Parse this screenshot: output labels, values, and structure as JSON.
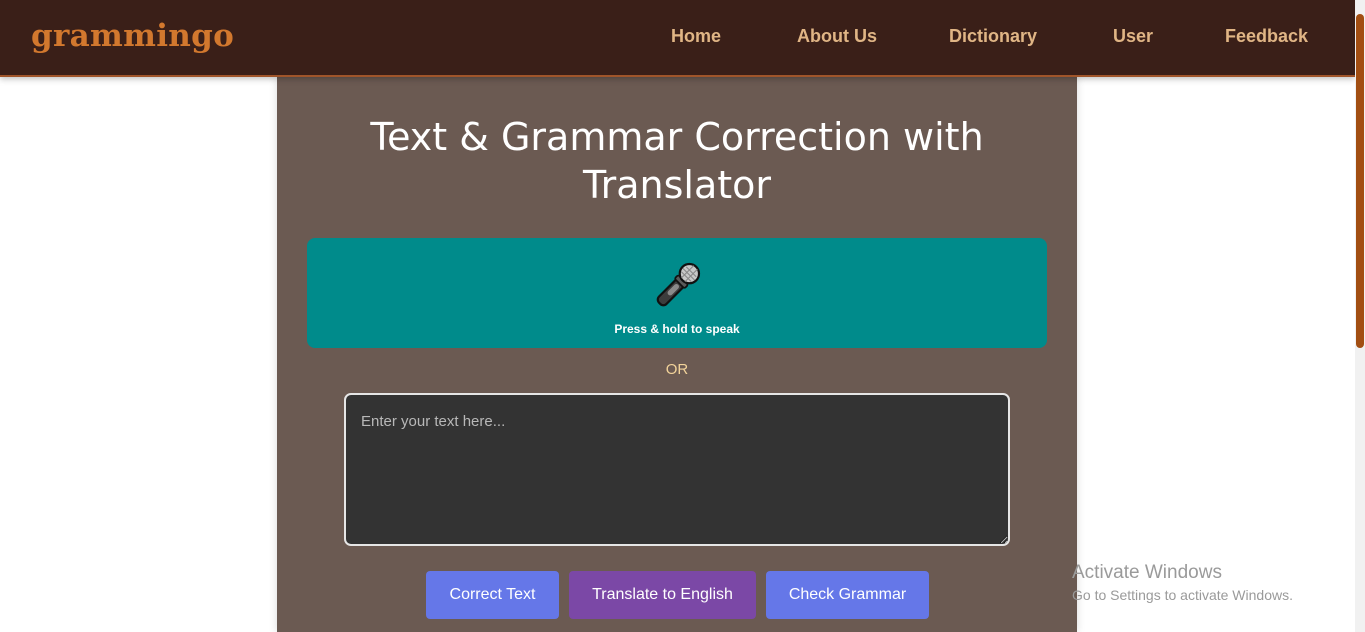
{
  "header": {
    "logo": "grammingo",
    "nav": [
      "Home",
      "About Us",
      "Dictionary",
      "User",
      "Feedback"
    ]
  },
  "main": {
    "title": "Text & Grammar Correction with Translator",
    "mic": {
      "icon": "microphone-icon",
      "label": "Press & hold to speak"
    },
    "or_text": "OR",
    "input_placeholder": "Enter your text here...",
    "input_value": "",
    "buttons": [
      {
        "label": "Correct Text",
        "color": "#6577e8"
      },
      {
        "label": "Translate to English",
        "color": "#7b48a6"
      },
      {
        "label": "Check Grammar",
        "color": "#6577e8"
      }
    ]
  },
  "watermark": {
    "title": "Activate Windows",
    "subtitle": "Go to Settings to activate Windows."
  },
  "colors": {
    "nav_bg": "#3a1f18",
    "logo": "#d2782e",
    "nav_link": "#e0b585",
    "card_bg": "#6b5a52",
    "mic_panel": "#008b8b",
    "or_text": "#f2d39a",
    "textarea_bg": "#333333",
    "scrollbar_thumb": "#a24e12"
  }
}
